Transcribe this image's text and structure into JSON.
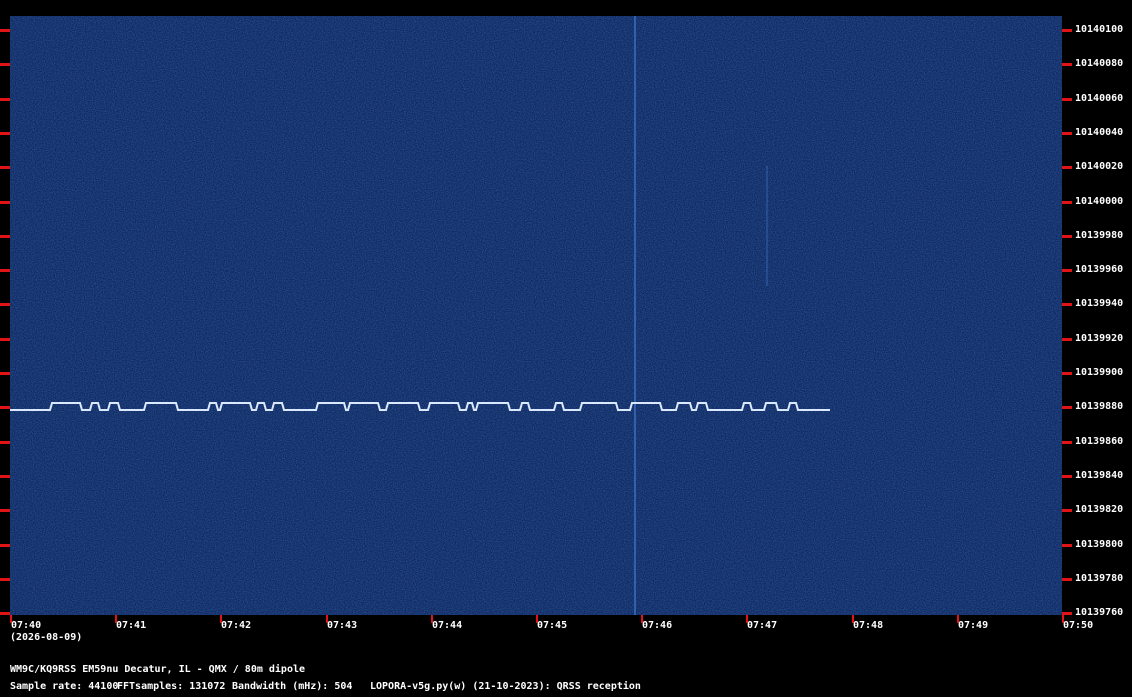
{
  "y_axis": {
    "ticks": [
      {
        "label": "10140100"
      },
      {
        "label": "10140080"
      },
      {
        "label": "10140060"
      },
      {
        "label": "10140040"
      },
      {
        "label": "10140020"
      },
      {
        "label": "10140000"
      },
      {
        "label": "10139980"
      },
      {
        "label": "10139960"
      },
      {
        "label": "10139940"
      },
      {
        "label": "10139920"
      },
      {
        "label": "10139900"
      },
      {
        "label": "10139880"
      },
      {
        "label": "10139860"
      },
      {
        "label": "10139840"
      },
      {
        "label": "10139820"
      },
      {
        "label": "10139800"
      },
      {
        "label": "10139780"
      },
      {
        "label": "10139760"
      }
    ]
  },
  "x_axis": {
    "ticks": [
      {
        "label": "07:40"
      },
      {
        "label": "07:41"
      },
      {
        "label": "07:42"
      },
      {
        "label": "07:43"
      },
      {
        "label": "07:44"
      },
      {
        "label": "07:45"
      },
      {
        "label": "07:46"
      },
      {
        "label": "07:47"
      },
      {
        "label": "07:48"
      },
      {
        "label": "07:49"
      },
      {
        "label": "07:50"
      }
    ],
    "date": "(2026-08-09)"
  },
  "footer": {
    "station": "WM9C/KQ9RSS EM59nu Decatur, IL - QMX / 80m dipole",
    "sample_rate": "Sample rate: 44100",
    "fft_samples": "FFTsamples: 131072",
    "bandwidth": "Bandwidth (mHz): 504",
    "software": "LOPORA-v5g.py(w) (21-10-2023): QRSS reception"
  },
  "colors": {
    "background": "#000000",
    "spectrogram": "#0f2a63",
    "signal": "#dbe9ff",
    "ticks": "#e01414",
    "text": "#ffffff"
  }
}
